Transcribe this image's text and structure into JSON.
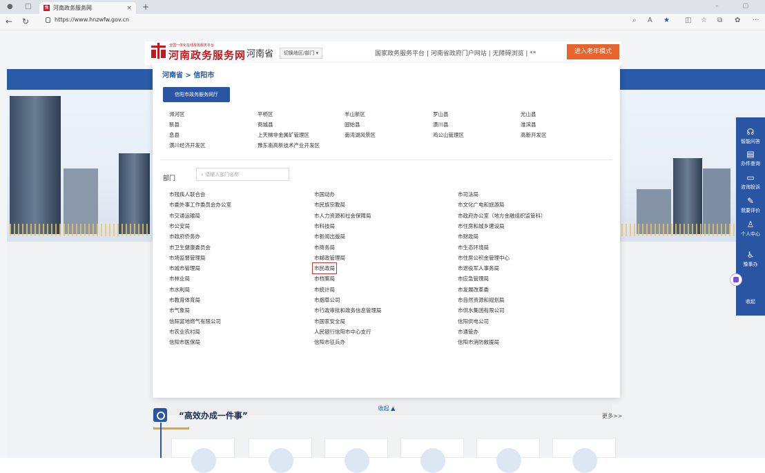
{
  "browser": {
    "tab_title": "河南政务服务网",
    "tab_favicon": "豫",
    "url": "https://www.hnzwfw.gov.cn"
  },
  "header": {
    "logo_small": "全国一体化在线政务服务平台",
    "logo_text": "河南政务服务网",
    "province": "河南省",
    "switch_label": "切换地区/部门 ▾",
    "top_links": "国家政务服务平台 | 河南省政府门户网站 | 无障碍浏览 | **",
    "old_mode_button": "进入老年模式"
  },
  "dropdown": {
    "breadcrumb": "河南省 > 信阳市",
    "city_hall_button": "信阳市政务服务网厅",
    "districts": [
      "浉河区",
      "平桥区",
      "羊山新区",
      "罗山县",
      "光山县",
      "新县",
      "商城县",
      "固始县",
      "潢川县",
      "淮滨县",
      "息县",
      "上天梯非金属矿管理区",
      "南湾湖风景区",
      "鸡公山管理区",
      "高新开发区",
      "潢川经济开发区",
      "豫东南高新技术产业开发区"
    ],
    "dept_label": "部门",
    "dept_search_placeholder": "请输入部门名称",
    "departments": [
      [
        "市残疾人联合会",
        "市国动办",
        "市司法局"
      ],
      [
        "市委外事工作委员会办公室",
        "市民族宗教局",
        "市文化广电和旅游局"
      ],
      [
        "市交通运输局",
        "市人力资源和社会保障局",
        "市政府办公室（地方金融组织监管科）"
      ],
      [
        "市公安局",
        "市科技局",
        "市住房和城乡建设局"
      ],
      [
        "市政府侨务办",
        "市新闻出版局",
        "市财政局"
      ],
      [
        "市卫生健康委员会",
        "市商务局",
        "市生态环境局"
      ],
      [
        "市场监督管理局",
        "市邮政管理局",
        "市住房公积金管理中心"
      ],
      [
        "市城市管理局",
        "市民政局",
        "市退役军人事务局"
      ],
      [
        "市林业局",
        "市档案局",
        "市应急管理局"
      ],
      [
        "市水利局",
        "市统计局",
        "市发展改革委"
      ],
      [
        "市教育体育局",
        "市烟草公司",
        "市自然资源和规划局"
      ],
      [
        "市气象局",
        "市行政审批和政务信息管理局",
        "市供水集团有限公司"
      ],
      [
        "信阳富地燃气有限公司",
        "市国家安全局",
        "信阳供电公司"
      ],
      [
        "市农业农村局",
        "人民银行信阳市中心支行",
        "市通管办"
      ],
      [
        "信阳市医保局",
        "信阳市征兵办",
        "信阳市消防救援局"
      ]
    ],
    "collapse_label": "收起 ▲"
  },
  "section": {
    "title": "“高效办成一件事”",
    "more": "更多>>"
  },
  "sidebar": {
    "items": [
      {
        "icon": "☊",
        "label": "智能问答"
      },
      {
        "icon": "▤",
        "label": "办件查询"
      },
      {
        "icon": "▭",
        "label": "咨询投诉"
      },
      {
        "icon": "✎",
        "label": "我要评价"
      },
      {
        "icon": "♙",
        "label": "个人中心"
      },
      {
        "icon": "♿",
        "label": "豫事办"
      },
      {
        "icon": "",
        "label": "收起"
      }
    ]
  }
}
